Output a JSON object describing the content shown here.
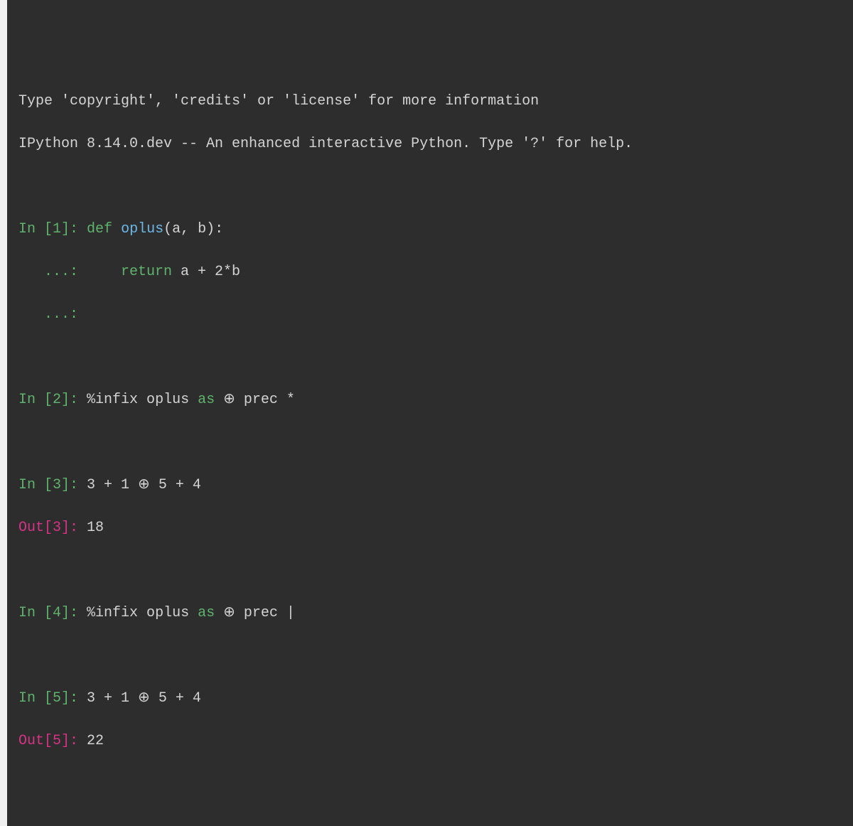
{
  "header": {
    "line1": "Type 'copyright', 'credits' or 'license' for more information",
    "line2": "IPython 8.14.0.dev -- An enhanced interactive Python. Type '?' for help."
  },
  "cells": {
    "c1": {
      "in_label": "In [",
      "in_num": "1",
      "in_close": "]: ",
      "kw_def": "def",
      "space1": " ",
      "fname": "oplus",
      "params": "(a, b):",
      "cont1": "   ...: ",
      "indent": "    ",
      "kw_return": "return",
      "expr": " a + 2*b",
      "cont2": "   ...: "
    },
    "c2": {
      "in_label": "In [",
      "in_num": "2",
      "in_close": "]: ",
      "magic": "%infix oplus ",
      "as_kw": "as",
      "rest1": " ⊕ prec *"
    },
    "c3": {
      "in_label": "In [",
      "in_num": "3",
      "in_close": "]: ",
      "expr": "3 + 1 ⊕ 5 + 4",
      "out_label": "Out[",
      "out_num": "3",
      "out_close": "]: ",
      "result": "18"
    },
    "c4": {
      "in_label": "In [",
      "in_num": "4",
      "in_close": "]: ",
      "magic": "%infix oplus ",
      "as_kw": "as",
      "rest1": " ⊕ prec |"
    },
    "c5": {
      "in_label": "In [",
      "in_num": "5",
      "in_close": "]: ",
      "expr": "3 + 1 ⊕ 5 + 4",
      "out_label": "Out[",
      "out_num": "5",
      "out_close": "]: ",
      "result": "22"
    }
  }
}
